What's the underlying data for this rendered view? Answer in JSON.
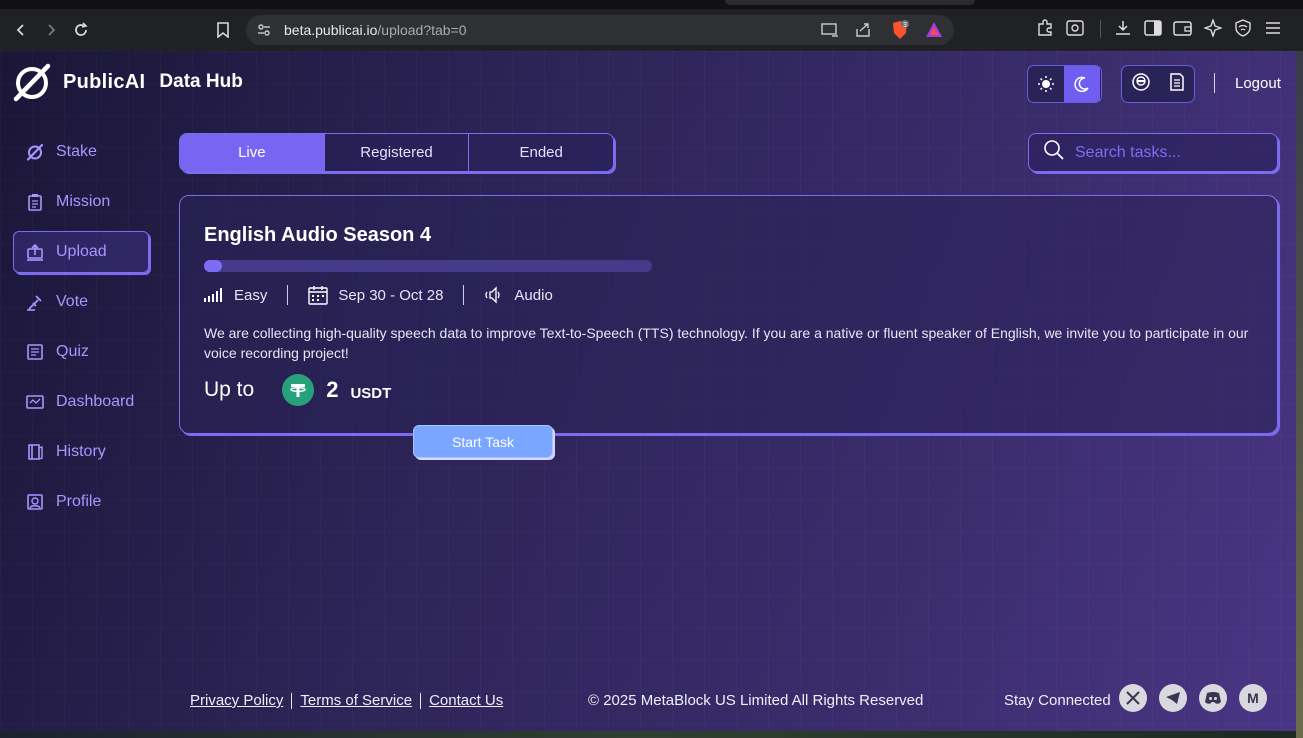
{
  "browser": {
    "url_host": "beta.publicai.io",
    "url_path": "/upload?tab=0",
    "brave_badge": "3"
  },
  "header": {
    "brand": "PublicAI",
    "hub": "Data Hub",
    "logout_label": "Logout"
  },
  "sidebar": {
    "items": [
      {
        "label": "Stake",
        "icon": "stake-icon"
      },
      {
        "label": "Mission",
        "icon": "mission-icon"
      },
      {
        "label": "Upload",
        "icon": "upload-icon",
        "active": true
      },
      {
        "label": "Vote",
        "icon": "vote-icon"
      },
      {
        "label": "Quiz",
        "icon": "quiz-icon"
      },
      {
        "label": "Dashboard",
        "icon": "dashboard-icon"
      },
      {
        "label": "History",
        "icon": "history-icon"
      },
      {
        "label": "Profile",
        "icon": "profile-icon"
      }
    ]
  },
  "tabs": [
    {
      "label": "Live",
      "active": true
    },
    {
      "label": "Registered"
    },
    {
      "label": "Ended"
    }
  ],
  "search": {
    "placeholder": "Search tasks..."
  },
  "task": {
    "title": "English Audio Season 4",
    "progress": 0.04,
    "difficulty": "Easy",
    "dates": "Sep 30 - Oct 28",
    "type": "Audio",
    "description": "We are collecting high-quality speech data to improve Text-to-Speech (TTS) technology. If you are a native or fluent speaker of English, we invite you to participate in our voice recording project!",
    "reward_prefix": "Up to",
    "reward_amount": "2",
    "reward_currency": "USDT",
    "start_label": "Start Task"
  },
  "footer": {
    "privacy": "Privacy Policy",
    "terms": "Terms of Service",
    "contact": "Contact Us",
    "copyright": "© 2025 MetaBlock US Limited All Rights Reserved",
    "stay": "Stay Connected",
    "medium_letter": "M"
  },
  "colors": {
    "accent": "#7d6cf0",
    "active_tab": "#7866f2",
    "start_button": "#7aa6ff",
    "usdt": "#27a17b"
  }
}
